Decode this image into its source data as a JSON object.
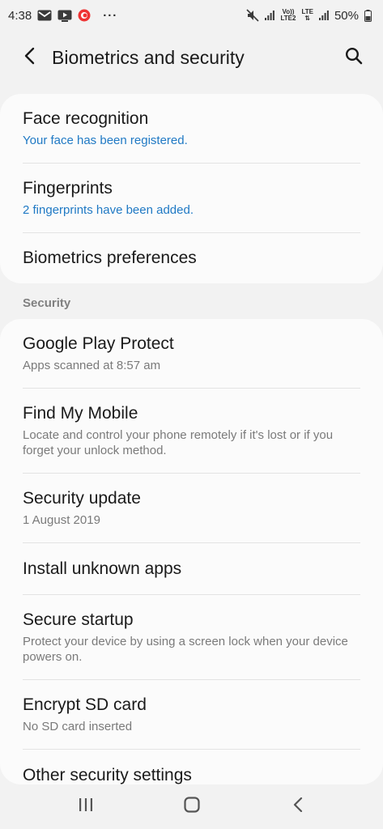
{
  "status_bar": {
    "time": "4:38",
    "dots": "···",
    "volte": "Vo))",
    "lte2": "LTE2",
    "lte": "LTE",
    "battery": "50%"
  },
  "header": {
    "title": "Biometrics and security"
  },
  "biometrics": [
    {
      "title": "Face recognition",
      "subtitle": "Your face has been registered."
    },
    {
      "title": "Fingerprints",
      "subtitle": "2 fingerprints have been added."
    },
    {
      "title": "Biometrics preferences"
    }
  ],
  "security_section_label": "Security",
  "security": [
    {
      "title": "Google Play Protect",
      "subtitle": "Apps scanned at 8:57 am"
    },
    {
      "title": "Find My Mobile",
      "subtitle": "Locate and control your phone remotely if it's lost or if you forget your unlock method."
    },
    {
      "title": "Security update",
      "subtitle": "1 August 2019"
    },
    {
      "title": "Install unknown apps"
    },
    {
      "title": "Secure startup",
      "subtitle": "Protect your device by using a screen lock when your device powers on."
    },
    {
      "title": "Encrypt SD card",
      "subtitle": "No SD card inserted"
    },
    {
      "title": "Other security settings"
    }
  ],
  "colors": {
    "accent": "#1f79c4",
    "background": "#f2f2f2",
    "card": "#fbfbfb"
  },
  "icons": [
    "gmail-icon",
    "media-icon",
    "app-notification-icon",
    "mute-icon",
    "signal-icon",
    "battery-icon",
    "back-arrow-icon",
    "search-icon",
    "recents-icon",
    "home-icon",
    "nav-back-icon"
  ]
}
